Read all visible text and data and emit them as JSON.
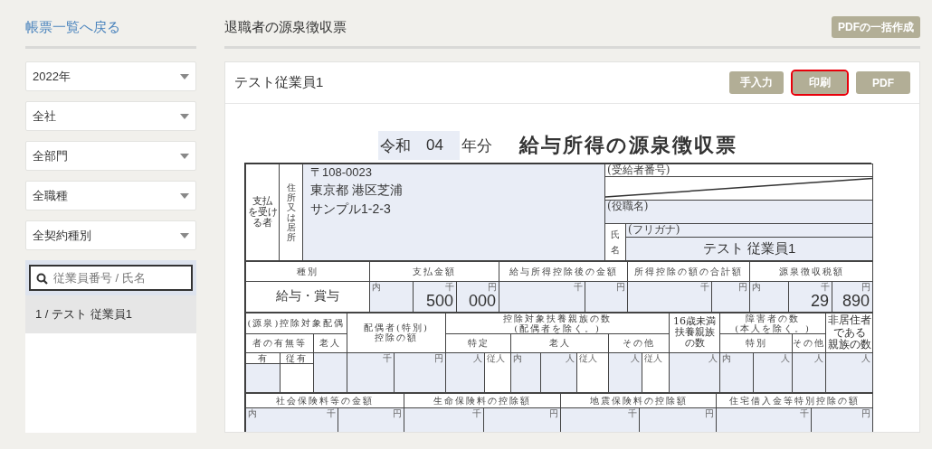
{
  "sidebar": {
    "back_link": "帳票一覧へ戻る",
    "filters": [
      {
        "value": "2022年"
      },
      {
        "value": "全社"
      },
      {
        "value": "全部門"
      },
      {
        "value": "全職種"
      },
      {
        "value": "全契約種別"
      }
    ],
    "search": {
      "placeholder": "従業員番号 / 氏名"
    },
    "employees": [
      {
        "label": "1 / テスト 従業員1",
        "selected": true
      }
    ]
  },
  "header": {
    "title": "退職者の源泉徴収票",
    "bulk_button": "PDFの一括作成"
  },
  "card": {
    "employee_name": "テスト従業員1",
    "buttons": [
      {
        "label": "手入力",
        "highlighted": false
      },
      {
        "label": "印刷",
        "highlighted": true
      },
      {
        "label": "PDF",
        "highlighted": false
      }
    ]
  },
  "form": {
    "era": "令和",
    "year": "04",
    "year_suffix": "年分",
    "title": "給与所得の源泉徴収票",
    "recipient": {
      "label": [
        "支払",
        "を受け",
        "る者"
      ],
      "address_label": "住所又は居所",
      "postal_code": "〒108-0023",
      "address_lines": [
        "東京都 港区芝浦",
        "サンプル1-2-3"
      ],
      "number_label": "(受給者番号)",
      "position_label": "(役職名)",
      "name_label": "氏名",
      "furigana_label": "(フリガナ)",
      "name": "テスト 従業員1"
    },
    "payment": {
      "headers": [
        "種別",
        "支払金額",
        "給与所得控除後の金額",
        "所得控除の額の合計額",
        "源泉徴収税額"
      ],
      "type": "給与・賞与",
      "groups": [
        [
          {
            "prefix": "内"
          },
          {
            "unit": "千",
            "value": "500"
          },
          {
            "unit": "円",
            "value": "000"
          }
        ],
        [
          {
            "unit": "千"
          },
          {
            "unit": "円"
          }
        ],
        [
          {
            "unit": "千"
          },
          {
            "unit": "円"
          }
        ],
        [
          {
            "prefix": "内"
          },
          {
            "unit": "千",
            "value": "29"
          },
          {
            "unit": "円",
            "value": "890"
          }
        ]
      ]
    },
    "dependents": {
      "spouse_header": "(源泉)控除対象配偶",
      "spouse_sub": "者の有無等",
      "spouse_elderly": "老人",
      "spouse_units": [
        "有",
        "従有"
      ],
      "spouse_deduction": "配偶者(特別)\n控除の額",
      "spouse_deduction_units": [
        {
          "unit": "千"
        },
        {
          "unit": "円"
        }
      ],
      "dependents_header": "控除対象扶養親族の数\n(配偶者を除く。)",
      "dependents_groups": [
        "特定",
        "老人",
        "その他"
      ],
      "dependents_units": [
        {
          "unit": "人"
        },
        {
          "prefix": "従人"
        },
        {
          "prefix": "内"
        },
        {
          "unit": "人"
        },
        {
          "prefix": "従人"
        },
        {
          "unit": "人"
        },
        {
          "prefix": "従人"
        }
      ],
      "under16": [
        "16歳未満",
        "扶養親族",
        "の数"
      ],
      "under16_unit": {
        "unit": "人"
      },
      "disabled_header": "障害者の数\n(本人を除く。)",
      "disabled_groups": [
        "特別",
        "その他"
      ],
      "disabled_units": [
        {
          "prefix": "内"
        },
        {
          "unit": "人"
        },
        {
          "unit": "人"
        }
      ],
      "nonresident": [
        "非居住者",
        "である",
        "親族の数"
      ],
      "nonresident_unit": {
        "unit": "人"
      }
    },
    "insurance": {
      "headers": [
        "社会保険料等の金額",
        "生命保険料の控除額",
        "地震保険料の控除額",
        "住宅借入金等特別控除の額"
      ],
      "groups": [
        [
          {
            "prefix": "内",
            "unit": "千"
          },
          {
            "unit": "円"
          }
        ],
        [
          {
            "unit": "千"
          },
          {
            "unit": "円"
          }
        ],
        [
          {
            "unit": "千"
          },
          {
            "unit": "円"
          }
        ],
        [
          {
            "unit": "千"
          },
          {
            "unit": "円"
          }
        ]
      ]
    }
  }
}
